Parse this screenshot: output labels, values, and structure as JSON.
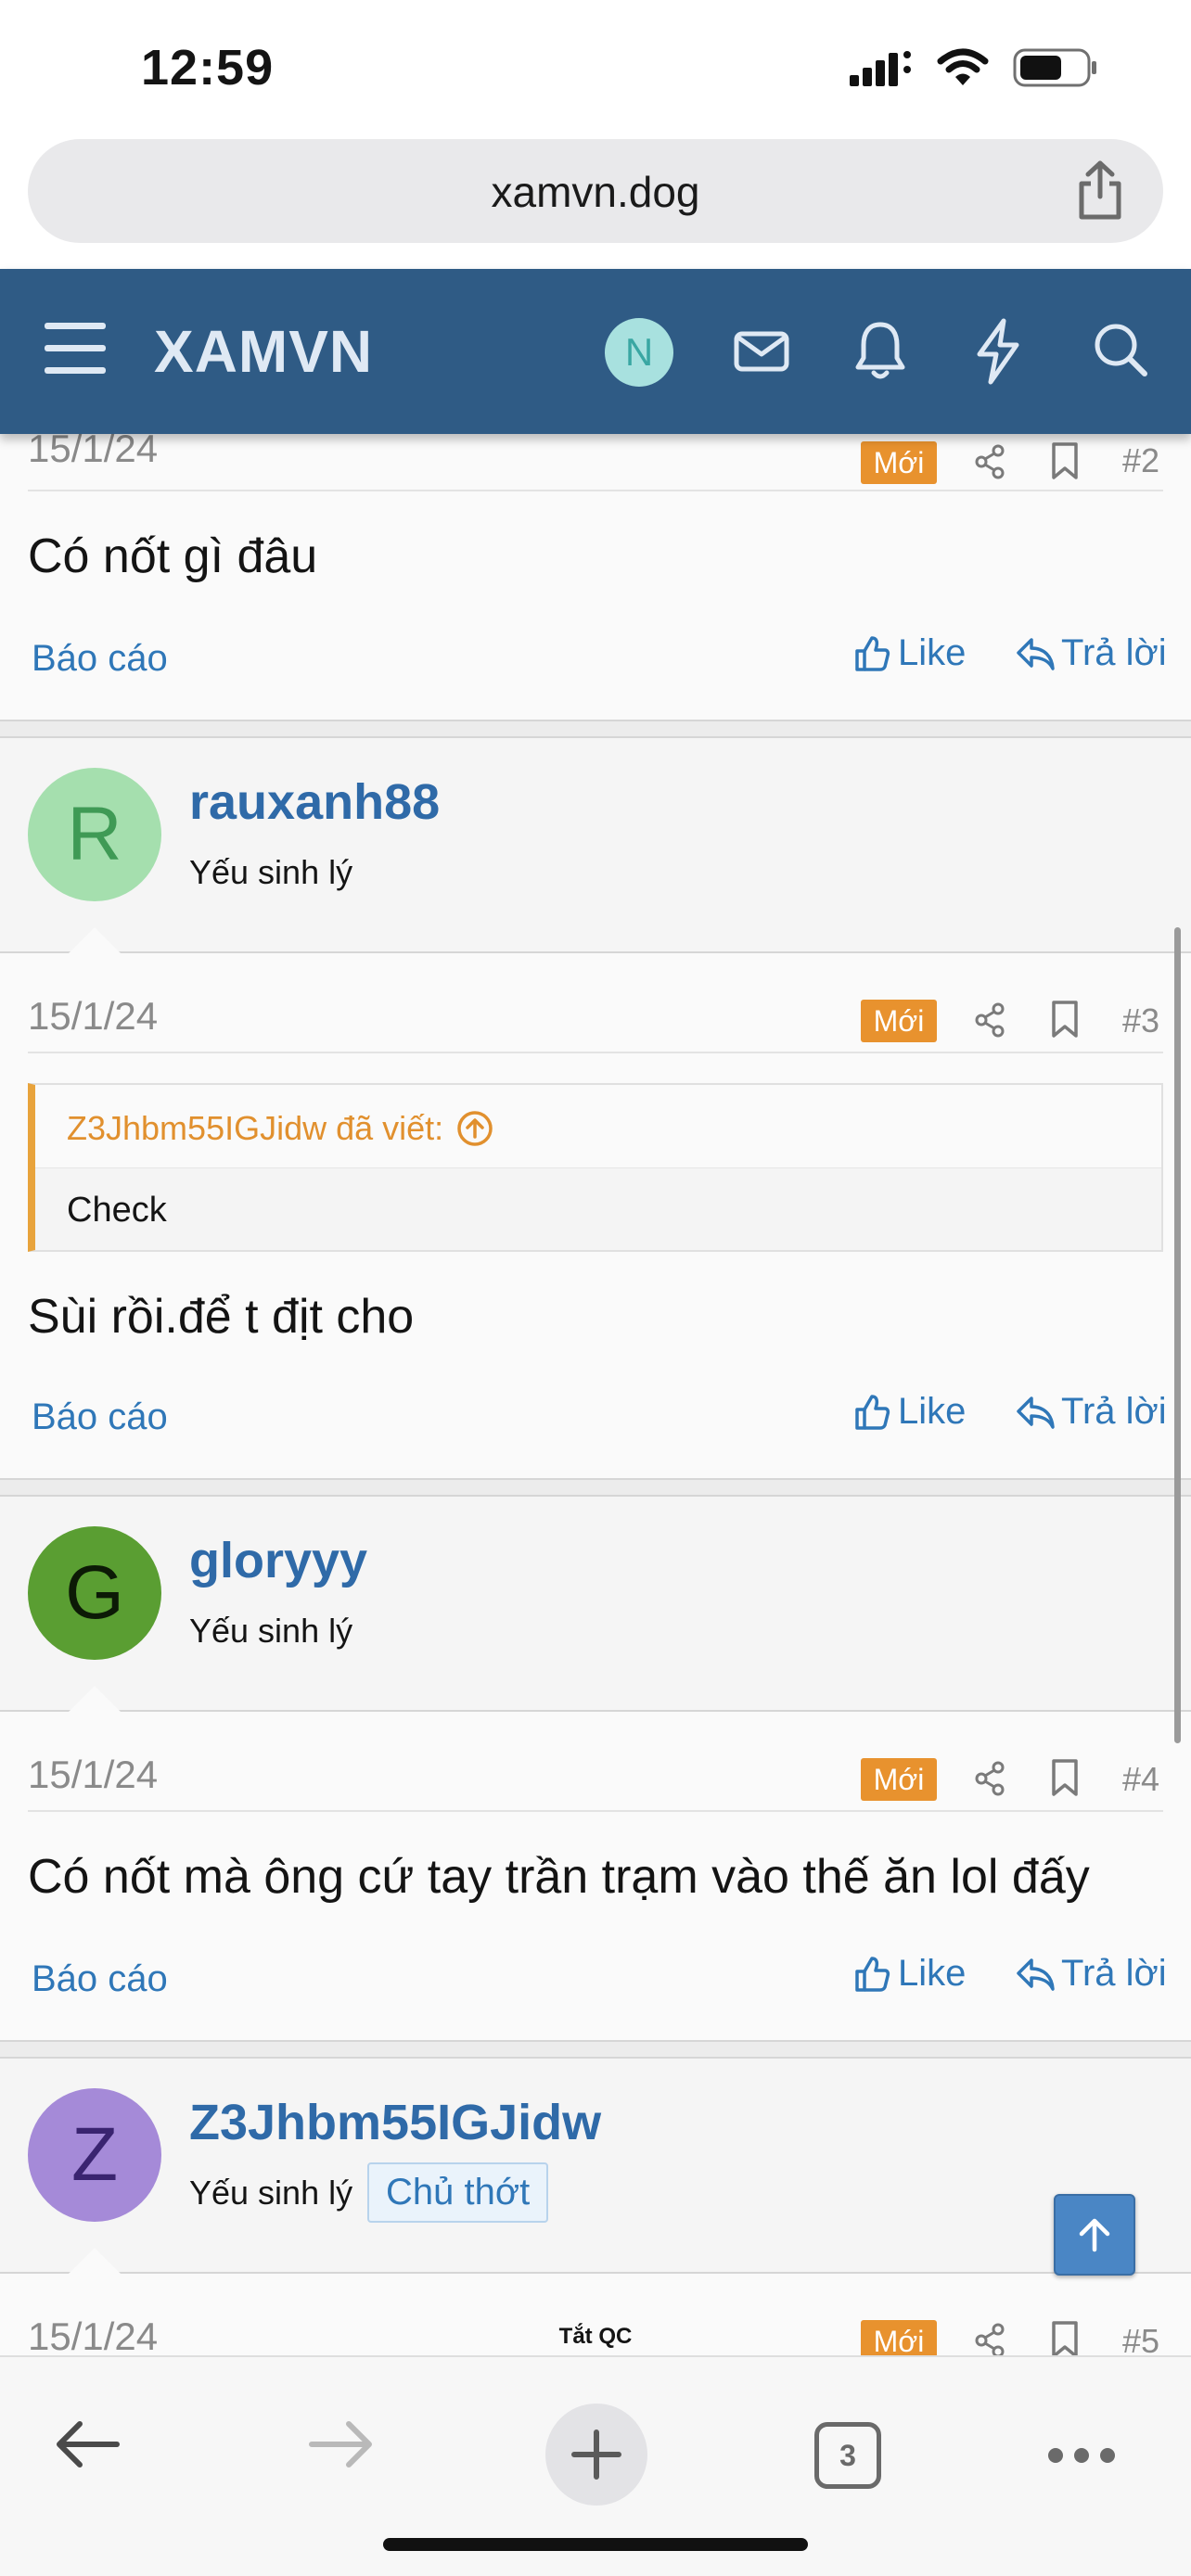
{
  "status_bar": {
    "time": "12:59"
  },
  "browser": {
    "url": "xamvn.dog",
    "tab_count": "3"
  },
  "site": {
    "logo": "XAMVN",
    "user_initial": "N"
  },
  "posts": [
    {
      "date": "15/1/24",
      "badge": "Mới",
      "number": "#2",
      "text": "Có nốt gì đâu",
      "report": "Báo cáo",
      "like": "Like",
      "reply": "Trả lời"
    },
    {
      "user": {
        "initial": "R",
        "name": "rauxanh88",
        "title": "Yếu sinh lý"
      },
      "date": "15/1/24",
      "badge": "Mới",
      "number": "#3",
      "quote": {
        "author": "Z3Jhbm55IGJidw đã viết:",
        "text": "Check"
      },
      "text": "Sùi rồi.để t địt cho",
      "report": "Báo cáo",
      "like": "Like",
      "reply": "Trả lời"
    },
    {
      "user": {
        "initial": "G",
        "name": "gloryyy",
        "title": "Yếu sinh lý"
      },
      "date": "15/1/24",
      "badge": "Mới",
      "number": "#4",
      "text": "Có nốt mà ông cứ tay trần trạm vào thế ăn lol đấy",
      "report": "Báo cáo",
      "like": "Like",
      "reply": "Trả lời"
    },
    {
      "user": {
        "initial": "Z",
        "name": "Z3Jhbm55IGJidw",
        "title": "Yếu sinh lý",
        "badge": "Chủ thớt"
      },
      "date": "15/1/24",
      "badge": "Mới",
      "number": "#5"
    }
  ],
  "ad_label": "Tắt QC",
  "colors": {
    "header": "#2f5b85",
    "link": "#2f77b8",
    "new_badge": "#e8922e",
    "avatar_r": "#a5dfae",
    "avatar_g": "#5a9e32",
    "avatar_z": "#a58ad8"
  }
}
